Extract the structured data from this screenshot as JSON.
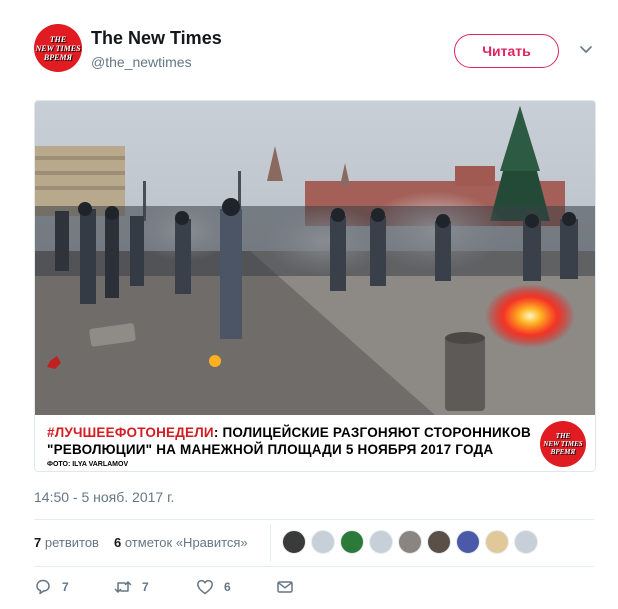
{
  "tweet": {
    "account_name": "The New Times",
    "handle": "@the_newtimes",
    "follow_label": "Читать",
    "timestamp": "14:50 - 5 нояб. 2017 г.",
    "avatar_logo": [
      "THE",
      "NEW TIMES",
      "ВРЕМЯ"
    ]
  },
  "media": {
    "caption_hashtag": "#ЛУЧШЕЕФОТОНЕДЕЛИ",
    "caption_line1_rest": ": ПОЛИЦЕЙСКИЕ РАЗГОНЯЮТ СТОРОННИКОВ",
    "caption_line2": "\"РЕВОЛЮЦИИ\" НА МАНЕЖНОЙ ПЛОЩАДИ 5 НОЯБРЯ 2017 ГОДА",
    "credit": "ФОТО: ILYA VARLAMOV",
    "logo_lines": [
      "THE",
      "NEW TIMES",
      "ВРЕМЯ"
    ]
  },
  "stats": {
    "retweets_count": "7",
    "retweets_label": "ретвитов",
    "likes_count": "6",
    "likes_label": "отметок «Нравится»"
  },
  "actions": {
    "reply_count": "7",
    "retweet_count": "7",
    "like_count": "6"
  },
  "colors": {
    "accent": "#e0245e",
    "secondary_text": "#657786",
    "brand_red": "#e01b22"
  }
}
